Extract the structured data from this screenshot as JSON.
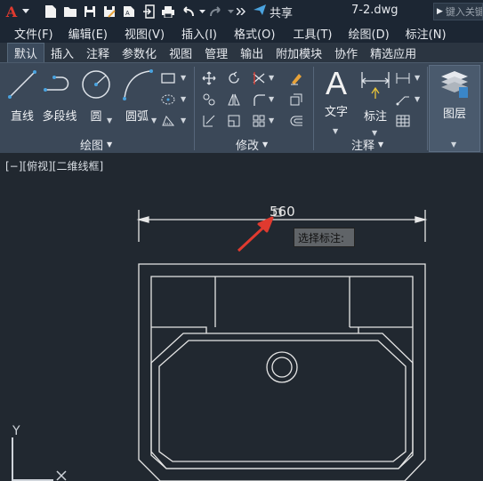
{
  "app": {
    "logo_letter": "A",
    "share_label": "共享",
    "filename": "7-2.dwg",
    "search_placeholder": "键入关键字"
  },
  "menu": [
    "文件(F)",
    "编辑(E)",
    "视图(V)",
    "插入(I)",
    "格式(O)",
    "工具(T)",
    "绘图(D)",
    "标注(N)"
  ],
  "tabs": [
    "默认",
    "插入",
    "注释",
    "参数化",
    "视图",
    "管理",
    "输出",
    "附加模块",
    "协作",
    "精选应用"
  ],
  "active_tab": "默认",
  "ribbon": {
    "draw": {
      "label": "绘图",
      "line": "直线",
      "polyline": "多段线",
      "circle": "圆",
      "arc": "圆弧"
    },
    "modify": {
      "label": "修改"
    },
    "annotation": {
      "label": "注释",
      "text": "文字",
      "dimension": "标注"
    },
    "layers": {
      "label": "图层"
    }
  },
  "viewport": {
    "view_label": "[−][俯视][二维线框]",
    "dimension_value": "560",
    "tooltip": "选择标注:",
    "axis_y": "Y"
  },
  "colors": {
    "titlebar": "#1c2633",
    "ribbon": "#3b4858",
    "canvas": "#212830",
    "accent_red": "#e03a2f",
    "icon_blue": "#4aa3df"
  }
}
